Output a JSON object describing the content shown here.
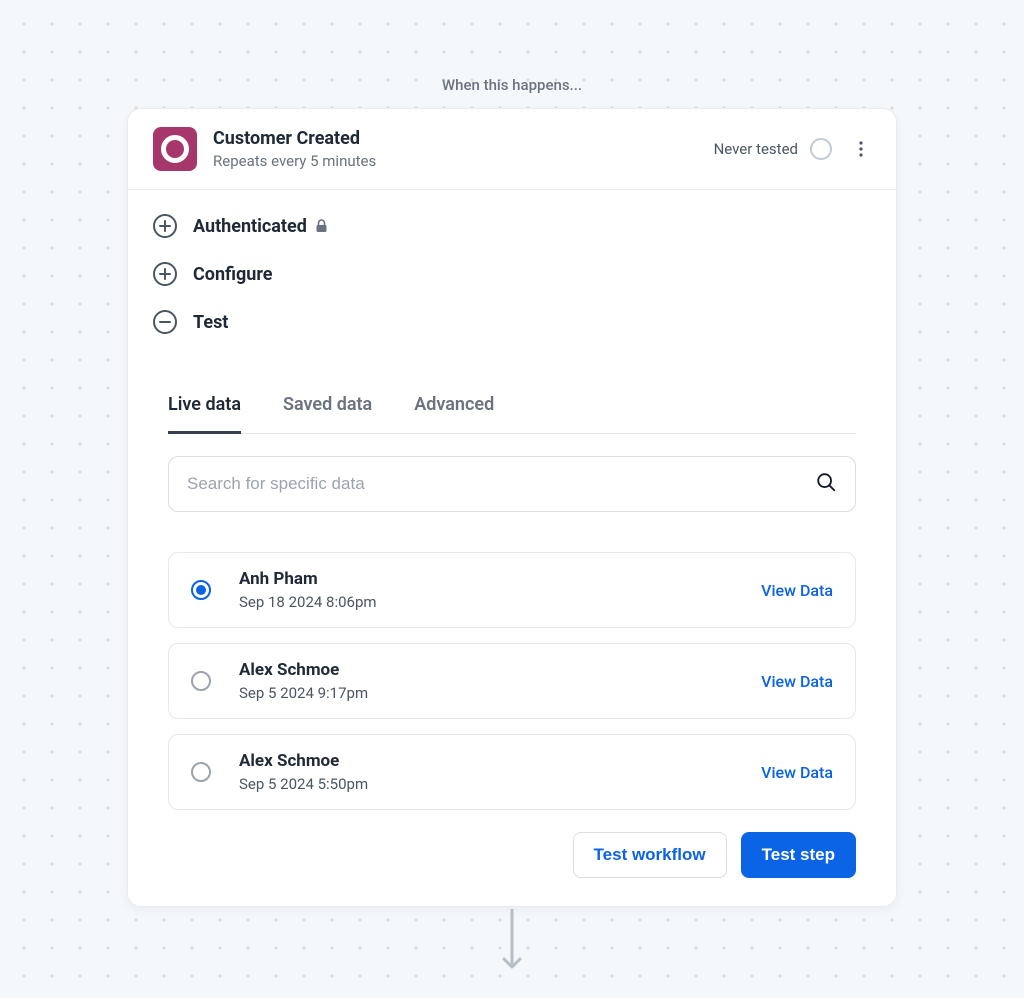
{
  "canvas": {
    "label": "When this happens..."
  },
  "header": {
    "title": "Customer Created",
    "subtitle": "Repeats every 5 minutes",
    "status": "Never tested"
  },
  "sections": {
    "authenticated": "Authenticated",
    "configure": "Configure",
    "test": "Test"
  },
  "tabs": {
    "live": "Live data",
    "saved": "Saved data",
    "advanced": "Advanced"
  },
  "search": {
    "placeholder": "Search for specific data"
  },
  "records": [
    {
      "name": "Anh Pham",
      "time": "Sep 18 2024 8:06pm",
      "view": "View Data",
      "selected": true
    },
    {
      "name": "Alex Schmoe",
      "time": "Sep 5 2024 9:17pm",
      "view": "View Data",
      "selected": false
    },
    {
      "name": "Alex Schmoe",
      "time": "Sep 5 2024 5:50pm",
      "view": "View Data",
      "selected": false
    }
  ],
  "actions": {
    "test_workflow": "Test workflow",
    "test_step": "Test step"
  }
}
